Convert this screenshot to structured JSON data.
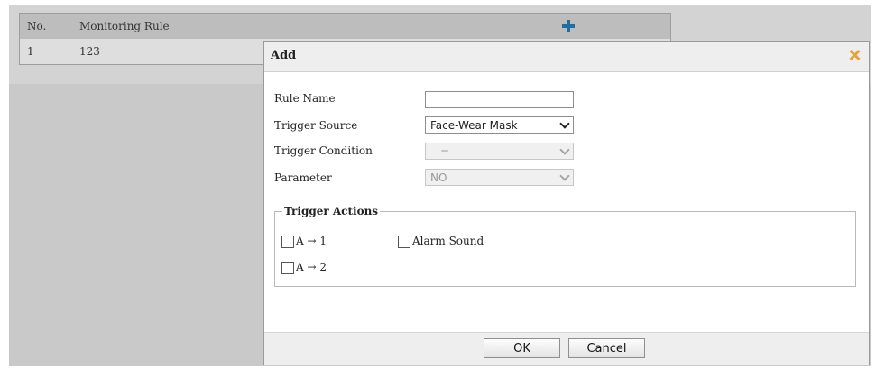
{
  "table": {
    "headers": {
      "no": "No.",
      "rule": "Monitoring Rule"
    },
    "rows": [
      {
        "no": "1",
        "rule": "123"
      }
    ]
  },
  "dialog": {
    "title": "Add",
    "fields": {
      "rule_name": {
        "label": "Rule Name",
        "value": ""
      },
      "trigger_source": {
        "label": "Trigger Source",
        "value": "Face-Wear Mask"
      },
      "trigger_condition": {
        "label": "Trigger Condition",
        "value": "="
      },
      "parameter": {
        "label": "Parameter",
        "value": "NO"
      }
    },
    "trigger_actions": {
      "legend": "Trigger Actions",
      "items": [
        {
          "label": "A → 1",
          "checked": false
        },
        {
          "label": "Alarm Sound",
          "checked": false
        },
        {
          "label": "A → 2",
          "checked": false
        }
      ]
    },
    "buttons": {
      "ok": "OK",
      "cancel": "Cancel"
    }
  },
  "colors": {
    "accent_plus": "#1e6fa0",
    "close_icon": "#e8a23c"
  },
  "icons": {
    "add": "plus-icon",
    "close": "close-icon",
    "dropdown": "chevron-down-icon"
  }
}
